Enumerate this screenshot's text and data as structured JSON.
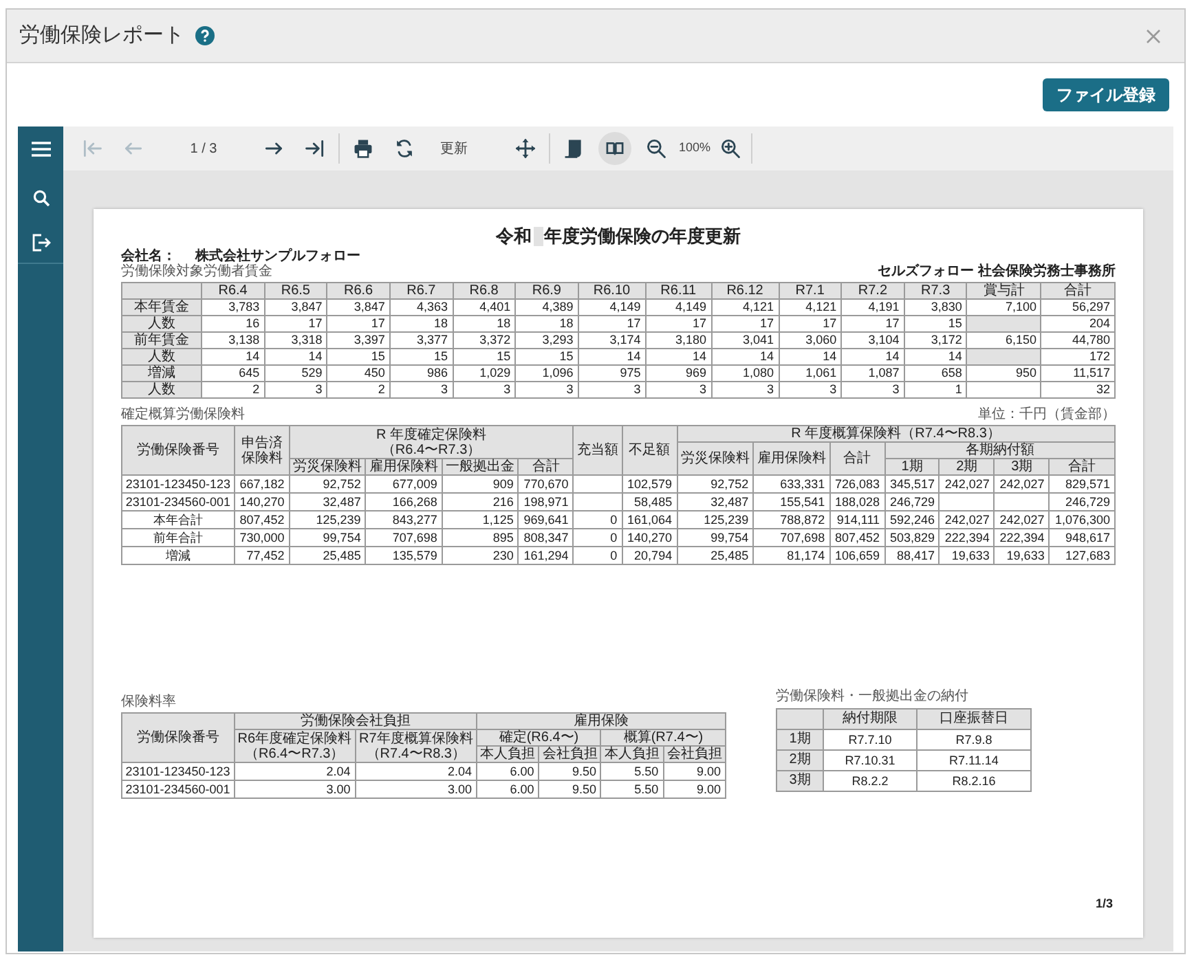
{
  "window": {
    "title": "労働保険レポート"
  },
  "register_button": {
    "label": "ファイル登録"
  },
  "toolbar": {
    "items": [
      {
        "kind": "first",
        "disabled": true,
        "selected": false
      },
      {
        "kind": "prev",
        "disabled": true,
        "selected": false
      },
      {
        "kind": "page",
        "label": "1 / 3"
      },
      {
        "kind": "next",
        "disabled": false,
        "selected": false
      },
      {
        "kind": "last",
        "disabled": false,
        "selected": false
      },
      {
        "kind": "print",
        "disabled": false,
        "selected": false
      },
      {
        "kind": "refresh",
        "disabled": false,
        "selected": false
      },
      {
        "kind": "label",
        "label": "更新"
      },
      {
        "kind": "move",
        "disabled": false,
        "selected": false
      },
      {
        "kind": "scroll",
        "disabled": false,
        "selected": false
      },
      {
        "kind": "book",
        "disabled": false,
        "selected": true
      },
      {
        "kind": "zoom_out",
        "disabled": false,
        "selected": false
      },
      {
        "kind": "zoom",
        "label": "100%"
      },
      {
        "kind": "zoom_in",
        "disabled": false,
        "selected": false
      }
    ]
  },
  "report": {
    "title_before": "令和",
    "title_after": "年度労働保険の年度更新",
    "company_label": "会社名：",
    "company": "株式会社サンプルフォロー",
    "office": "セルズフォロー 社会保険労務士事務所",
    "wage_table": {
      "caption": "労働保険対象労働者賃金",
      "columns": [
        "R6.4",
        "R6.5",
        "R6.6",
        "R6.7",
        "R6.8",
        "R6.9",
        "R6.10",
        "R6.11",
        "R6.12",
        "R7.1",
        "R7.2",
        "R7.3",
        "賞与計",
        "合計"
      ],
      "rows": [
        {
          "label": "本年賃金",
          "cells": [
            "3,783",
            "3,847",
            "3,847",
            "4,363",
            "4,401",
            "4,389",
            "4,149",
            "4,149",
            "4,121",
            "4,121",
            "4,191",
            "3,830"
          ],
          "bonus": "7,100",
          "bonus_shaded": false,
          "total": "56,297"
        },
        {
          "label": "人数",
          "cells": [
            "16",
            "17",
            "17",
            "18",
            "18",
            "18",
            "17",
            "17",
            "17",
            "17",
            "17",
            "15"
          ],
          "bonus_shaded": true,
          "total": "204"
        },
        {
          "label": "前年賃金",
          "cells": [
            "3,138",
            "3,318",
            "3,397",
            "3,377",
            "3,372",
            "3,293",
            "3,174",
            "3,180",
            "3,041",
            "3,060",
            "3,104",
            "3,172"
          ],
          "bonus": "6,150",
          "bonus_shaded": false,
          "total": "44,780"
        },
        {
          "label": "人数",
          "cells": [
            "14",
            "14",
            "15",
            "15",
            "15",
            "15",
            "14",
            "14",
            "14",
            "14",
            "14",
            "14"
          ],
          "bonus_shaded": true,
          "total": "172"
        },
        {
          "label": "増減",
          "cells": [
            "645",
            "529",
            "450",
            "986",
            "1,029",
            "1,096",
            "975",
            "969",
            "1,080",
            "1,061",
            "1,087",
            "658"
          ],
          "bonus": "950",
          "bonus_shaded": false,
          "total": "11,517"
        },
        {
          "label": "人数",
          "cells": [
            "2",
            "3",
            "2",
            "3",
            "3",
            "3",
            "3",
            "3",
            "3",
            "3",
            "3",
            "1"
          ],
          "bonus_shaded": false,
          "total": "32"
        }
      ]
    },
    "premium_table": {
      "caption": "確定概算労働保険料",
      "unit": "単位：千円（賃金部）",
      "headers": {
        "number": "労働保険番号",
        "declared": "申告済",
        "declared_2": "保険料",
        "confirmed": "R 年度確定保険料",
        "confirmed_period": "（R6.4〜R7.3）",
        "confirmed_cols": [
          "労災保険料",
          "雇用保険料",
          "一般拠出金",
          "合計"
        ],
        "applied": "充当額",
        "shortage": "不足額",
        "estimated": "R 年度概算保険料（R7.4〜R8.3）",
        "estimated_cols": [
          "労災保険料",
          "雇用保険料",
          "合計"
        ],
        "installments": "各期納付額",
        "installment_cols": [
          "1期",
          "2期",
          "3期",
          "合計"
        ]
      },
      "rows": [
        {
          "label": "23101-123450-123",
          "cells": [
            "667,182",
            "92,752",
            "677,009",
            "909",
            "770,670",
            null,
            "102,579",
            "92,752",
            "633,331",
            "726,083",
            "345,517",
            "242,027",
            "242,027",
            "829,571"
          ]
        },
        {
          "label": "23101-234560-001",
          "cells": [
            "140,270",
            "32,487",
            "166,268",
            "216",
            "198,971",
            null,
            "58,485",
            "32,487",
            "155,541",
            "188,028",
            "246,729",
            null,
            null,
            "246,729"
          ]
        },
        {
          "label": "本年合計",
          "cells": [
            "807,452",
            "125,239",
            "843,277",
            "1,125",
            "969,641",
            "0",
            "161,064",
            "125,239",
            "788,872",
            "914,111",
            "592,246",
            "242,027",
            "242,027",
            "1,076,300"
          ]
        },
        {
          "label": "前年合計",
          "cells": [
            "730,000",
            "99,754",
            "707,698",
            "895",
            "808,347",
            "0",
            "140,270",
            "99,754",
            "707,698",
            "807,452",
            "503,829",
            "222,394",
            "222,394",
            "948,617"
          ]
        },
        {
          "label": "増減",
          "cells": [
            "77,452",
            "25,485",
            "135,579",
            "230",
            "161,294",
            "0",
            "20,794",
            "25,485",
            "81,174",
            "106,659",
            "88,417",
            "19,633",
            "19,633",
            "127,683"
          ]
        }
      ]
    },
    "rate_table": {
      "caption": "保険料率",
      "headers": {
        "number": "労働保険番号",
        "company": "労働保険会社負担",
        "confirmed": "R6年度確定保険料",
        "confirmed_period": "（R6.4〜R7.3）",
        "estimated": "R7年度概算保険料",
        "estimated_period": "（R7.4〜R8.3）",
        "employment": "雇用保険",
        "emp_confirmed": "確定(R6.4〜)",
        "emp_estimated": "概算(R7.4〜)",
        "sub_cols": [
          "本人負担",
          "会社負担",
          "本人負担",
          "会社負担"
        ]
      },
      "rows": [
        {
          "label": "23101-123450-123",
          "cells": [
            "2.04",
            "2.04",
            "6.00",
            "9.50",
            "5.50",
            "9.00"
          ]
        },
        {
          "label": "23101-234560-001",
          "cells": [
            "3.00",
            "3.00",
            "6.00",
            "9.50",
            "5.50",
            "9.00"
          ]
        }
      ]
    },
    "payment_table": {
      "caption": "労働保険料・一般拠出金の納付",
      "columns": [
        "納付期限",
        "口座振替日"
      ],
      "rows": [
        {
          "label": "1期",
          "cells": [
            "R7.7.10",
            "R7.9.8"
          ]
        },
        {
          "label": "2期",
          "cells": [
            "R7.10.31",
            "R7.11.14"
          ]
        },
        {
          "label": "3期",
          "cells": [
            "R8.2.2",
            "R8.2.16"
          ]
        }
      ]
    },
    "page_number": "1/3"
  }
}
